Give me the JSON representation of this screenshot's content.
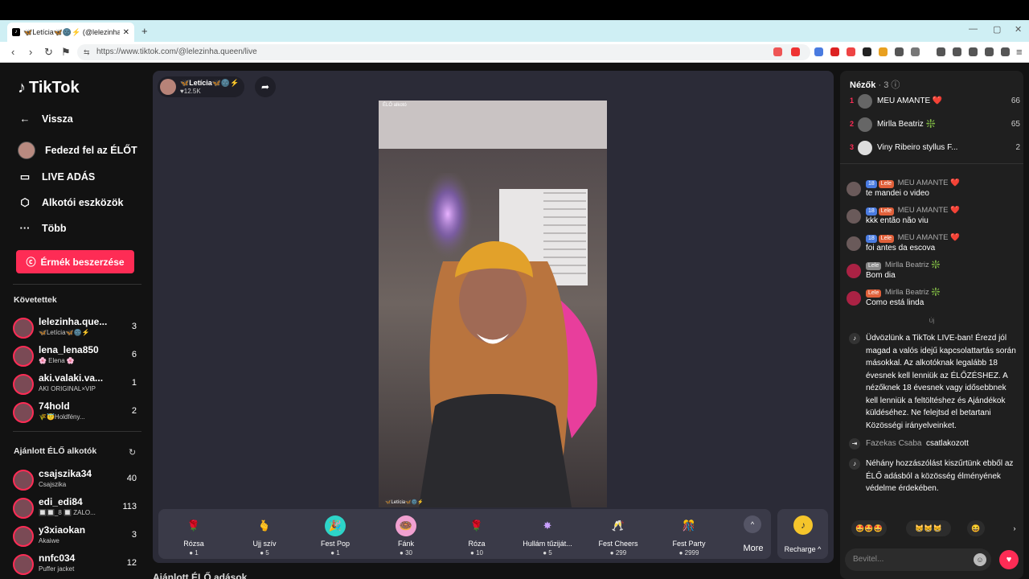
{
  "browser": {
    "tab_title": "🦋Letícia🦋🌚⚡ (@lelezinha...",
    "tab_close": "✕",
    "new_tab": "+",
    "url": "https://www.tiktok.com/@lelezinha.queen/live",
    "url_icon": "⇆"
  },
  "sidebar": {
    "logo": "TikTok",
    "nav": [
      {
        "label": "Vissza",
        "icon": "←"
      },
      {
        "label": "Fedezd fel az ÉLŐT",
        "icon": "avatar"
      },
      {
        "label": "LIVE ADÁS",
        "icon": "▭"
      },
      {
        "label": "Alkotói eszközök",
        "icon": "⬡"
      },
      {
        "label": "Több",
        "icon": "···"
      }
    ],
    "coin_button": "Érmék beszerzése",
    "following_header": "Követettek",
    "following": [
      {
        "name": "lelezinha.que...",
        "sub": "🦋Letícia🦋🌚⚡",
        "count": "3"
      },
      {
        "name": "lena_lena850",
        "sub": "🌸 Elena 🌸",
        "count": "6"
      },
      {
        "name": "aki.valaki.va...",
        "sub": "AKI ORIGINAL×VIP",
        "count": "1"
      },
      {
        "name": "74hold",
        "sub": "🌾😇Holdfény...",
        "count": "2"
      }
    ],
    "recommended_header": "Ajánlott ÉLŐ alkotók",
    "recommended": [
      {
        "name": "csajszika34",
        "sub": "Csajszika",
        "count": "40"
      },
      {
        "name": "edi_edi84",
        "sub": "🔲🔲_8 🔲 ZALO...",
        "count": "113"
      },
      {
        "name": "y3xiaokan",
        "sub": "Akaiwe",
        "count": "3"
      },
      {
        "name": "nnfc034",
        "sub": "Puffer jacket",
        "count": "12"
      }
    ]
  },
  "live": {
    "host_name": "🦋Letícia🦋🌚⚡",
    "host_likes": "♥12.5K",
    "video_tag": "ÉLŐ alkotó",
    "video_bottom": "🦋Letícia🦋🌚⚡",
    "gifts": [
      {
        "name": "Rózsa",
        "price": "1",
        "icon": "🌹",
        "color": "#3a3a48"
      },
      {
        "name": "Ujj szív",
        "price": "5",
        "icon": "🫰",
        "color": "#3a3a48"
      },
      {
        "name": "Fest Pop",
        "price": "1",
        "icon": "🎉",
        "color": "#2dd4c8"
      },
      {
        "name": "Fánk",
        "price": "30",
        "icon": "🍩",
        "color": "#f0a0d0"
      },
      {
        "name": "Róza",
        "price": "10",
        "icon": "🌹",
        "color": "#3a3a48"
      },
      {
        "name": "Hullám tűziját...",
        "price": "5",
        "icon": "✸",
        "color": "#3a3a48"
      },
      {
        "name": "Fest Cheers",
        "price": "299",
        "icon": "🥂",
        "color": "#3a3a48"
      },
      {
        "name": "Fest Party",
        "price": "2999",
        "icon": "🎊",
        "color": "#3a3a48"
      }
    ],
    "more_label": "More",
    "more_icon": "^",
    "recharge_label": "Recharge ^",
    "recharge_icon": "♪",
    "below_title": "Ajánlott ÉLŐ adások"
  },
  "chat": {
    "viewers_title": "Nézők",
    "viewers_count": "· 3 ⓘ",
    "viewers": [
      {
        "rank": "1",
        "name": "MEU AMANTE ❤️",
        "score": "66"
      },
      {
        "rank": "2",
        "name": "Mirlla Beatriz ❇️",
        "score": "65"
      },
      {
        "rank": "3",
        "name": "Viny Ribeiro styllus F...",
        "score": "2"
      }
    ],
    "messages": [
      {
        "name": "MEU AMANTE ❤️",
        "lvl": "18",
        "fan": "Lele",
        "text": "te mandei o video"
      },
      {
        "name": "MEU AMANTE ❤️",
        "lvl": "18",
        "fan": "Lele",
        "text": "kkk então não viu"
      },
      {
        "name": "MEU AMANTE ❤️",
        "lvl": "18",
        "fan": "Lele",
        "text": "foi antes da escova"
      },
      {
        "name": "Mirlla Beatriz ❇️",
        "lvl": "",
        "fan": "Lele",
        "text": "Bom dia"
      },
      {
        "name": "Mirlla Beatriz ❇️",
        "lvl": "",
        "fan": "Lele",
        "text": "Como está linda"
      }
    ],
    "new_marker": "Új",
    "system1": "Üdvözlünk a TikTok LIVE-ban! Érezd jól magad a valós idejű kapcsolattartás során másokkal. Az alkotóknak legalább 18 évesnek kell lenniük az ÉLŐZÉSHEZ. A nézőknek 18 évesnek vagy idősebbnek kell lenniük a feltöltéshez és Ajándékok küldéséhez. Ne felejtsd el betartani Közösségi irányelveinket.",
    "join_name": "Fazekas Csaba",
    "join_text": "csatlakozott",
    "system2": "Néhány hozzászólást kiszűrtünk ebből az ÉLŐ adásból a közösség élményének védelme érdekében.",
    "emojis": [
      "🤩🤩🤩",
      "😸😸😸",
      "😆"
    ],
    "input_placeholder": "Bevitel...",
    "emoji_btn": "☺",
    "heart_btn": "♥"
  }
}
